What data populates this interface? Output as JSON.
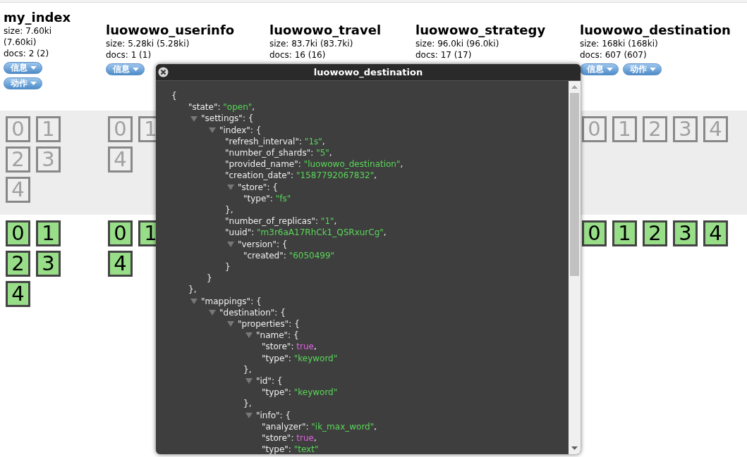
{
  "shard_bands": [
    {
      "kind": "unassigned"
    },
    {
      "kind": "started"
    }
  ],
  "indices": [
    {
      "name": "my_index",
      "size": "size: 7.60ki (7.60ki)",
      "docs": "docs: 2 (2)",
      "buttons": [
        "信息",
        "动作"
      ],
      "shards": [
        [
          [
            "0",
            "1"
          ],
          [
            "2",
            "3"
          ],
          [
            "4"
          ]
        ],
        [
          [
            "0",
            "1"
          ],
          [
            "2",
            "3"
          ],
          [
            "4"
          ]
        ]
      ]
    },
    {
      "name": "luowowo_userinfo",
      "size": "size: 5.28ki (5.28ki)",
      "docs": "docs: 1 (1)",
      "buttons": [
        "信息"
      ],
      "shards": [
        [
          [
            "0",
            "1"
          ],
          [
            "4"
          ]
        ],
        [
          [
            "0",
            "1"
          ],
          [
            "4"
          ]
        ]
      ]
    },
    {
      "name": "luowowo_travel",
      "size": "size: 83.7ki (83.7ki)",
      "docs": "docs: 16 (16)"
    },
    {
      "name": "luowowo_strategy",
      "size": "size: 96.0ki (96.0ki)",
      "docs": "docs: 17 (17)"
    },
    {
      "name": "luowowo_destination",
      "size": "size: 168ki (168ki)",
      "docs": "docs: 607 (607)",
      "buttons": [
        "信息",
        "动作"
      ],
      "shards": [
        [
          [
            "0",
            "1",
            "2",
            "3",
            "4"
          ]
        ],
        [
          [
            "0",
            "1",
            "2",
            "3",
            "4"
          ]
        ]
      ]
    }
  ],
  "dialog": {
    "title": "luowowo_destination",
    "json": {
      "open": "{",
      "children": [
        {
          "key": "\"state\":",
          "value": "\"open\"",
          "kind": "string",
          "trail": ","
        },
        {
          "key": "\"settings\": {",
          "expanded": true,
          "close": "},",
          "children": [
            {
              "key": "\"index\": {",
              "expanded": true,
              "close": "}",
              "children": [
                {
                  "key": "\"refresh_interval\":",
                  "value": "\"1s\"",
                  "kind": "string",
                  "trail": ","
                },
                {
                  "key": "\"number_of_shards\":",
                  "value": "\"5\"",
                  "kind": "string",
                  "trail": ","
                },
                {
                  "key": "\"provided_name\":",
                  "value": "\"luowowo_destination\"",
                  "kind": "string",
                  "trail": ","
                },
                {
                  "key": "\"creation_date\":",
                  "value": "\"1587792067832\"",
                  "kind": "string",
                  "trail": ","
                },
                {
                  "key": "\"store\": {",
                  "expanded": true,
                  "close": "},",
                  "children": [
                    {
                      "key": "\"type\":",
                      "value": "\"fs\"",
                      "kind": "string"
                    }
                  ]
                },
                {
                  "key": "\"number_of_replicas\":",
                  "value": "\"1\"",
                  "kind": "string",
                  "trail": ","
                },
                {
                  "key": "\"uuid\":",
                  "value": "\"m3r6aA17RhCk1_QSRxurCg\"",
                  "kind": "string",
                  "trail": ","
                },
                {
                  "key": "\"version\": {",
                  "expanded": true,
                  "close": "}",
                  "children": [
                    {
                      "key": "\"created\":",
                      "value": "\"6050499\"",
                      "kind": "string"
                    }
                  ]
                }
              ]
            }
          ]
        },
        {
          "key": "\"mappings\": {",
          "expanded": true,
          "children": [
            {
              "key": "\"destination\": {",
              "expanded": true,
              "children": [
                {
                  "key": "\"properties\": {",
                  "expanded": true,
                  "children": [
                    {
                      "key": "\"name\": {",
                      "expanded": true,
                      "close": "},",
                      "children": [
                        {
                          "key": "\"store\":",
                          "value": "true",
                          "kind": "boolean",
                          "trail": ","
                        },
                        {
                          "key": "\"type\":",
                          "value": "\"keyword\"",
                          "kind": "string"
                        }
                      ]
                    },
                    {
                      "key": "\"id\": {",
                      "expanded": true,
                      "close": "},",
                      "children": [
                        {
                          "key": "\"type\":",
                          "value": "\"keyword\"",
                          "kind": "string"
                        }
                      ]
                    },
                    {
                      "key": "\"info\": {",
                      "expanded": true,
                      "children": [
                        {
                          "key": "\"analyzer\":",
                          "value": "\"ik_max_word\"",
                          "kind": "string",
                          "trail": ","
                        },
                        {
                          "key": "\"store\":",
                          "value": "true",
                          "kind": "boolean",
                          "trail": ","
                        },
                        {
                          "key": "\"type\":",
                          "value": "\"text\"",
                          "kind": "string"
                        }
                      ]
                    }
                  ]
                }
              ]
            }
          ]
        }
      ]
    }
  }
}
